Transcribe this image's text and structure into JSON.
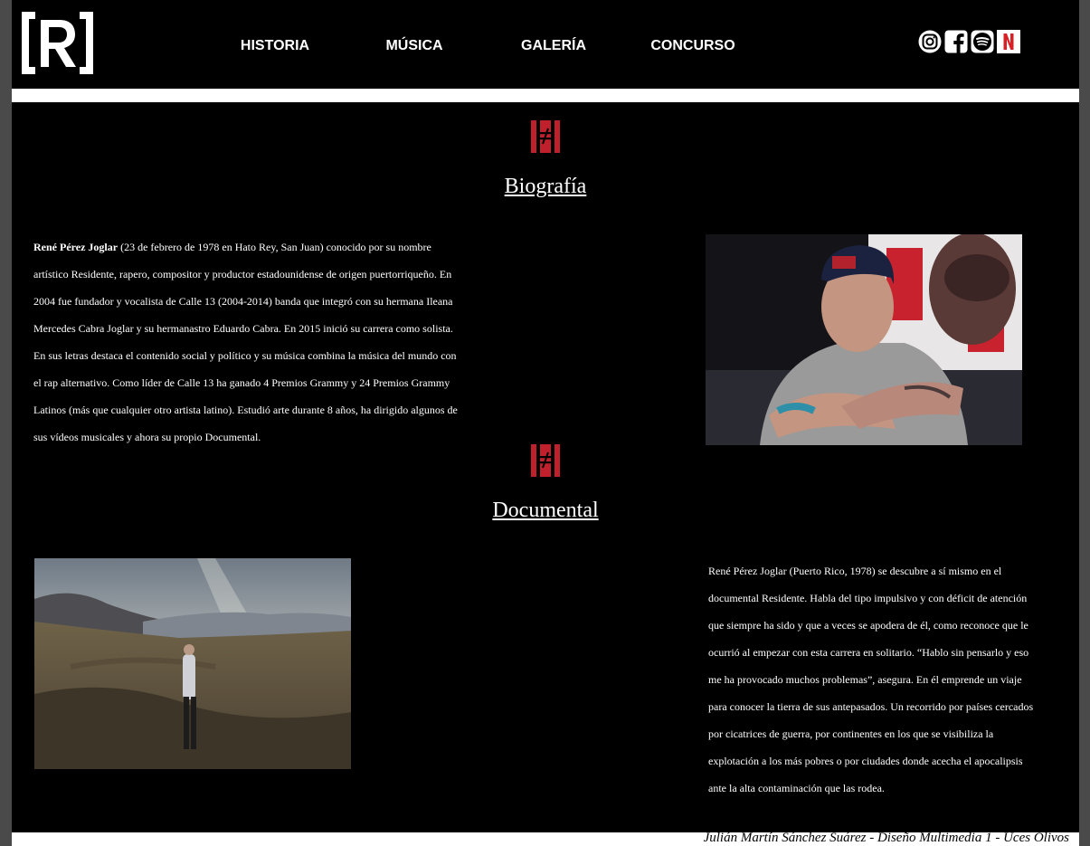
{
  "header": {
    "logo_text": "[R]",
    "nav": [
      {
        "label": "HISTORIA"
      },
      {
        "label": "MÚSICA"
      },
      {
        "label": "GALERÍA"
      },
      {
        "label": "CONCURSO"
      }
    ],
    "social_icons": [
      "instagram-icon",
      "facebook-icon",
      "spotify-icon",
      "netflix-icon"
    ]
  },
  "biography": {
    "title": "Biografía",
    "name_bold": "René Pérez Joglar",
    "text": " (23 de febrero de 1978 en Hato Rey, San Juan) conocido por su nombre artístico Residente, rapero, compositor y productor estadounidense de origen puertorriqueño. En 2004 fue fundador y vocalista de Calle 13 (2004-2014) banda que integró con su hermana Ileana Mercedes Cabra Joglar y su hermanastro Eduardo Cabra. En 2015 inició su carrera como solista. En sus letras destaca el contenido social y político y su música combina la música del mundo con el rap alternativo. Como líder de Calle 13 ha ganado 4 Premios Grammy y 24 Premios Grammy Latinos (más que cualquier otro artista latino). Estudió arte durante 8 años, ha dirigido algunos de sus vídeos musicales y ahora su propio Documental."
  },
  "documentary": {
    "title": "Documental",
    "text": "René Pérez Joglar (Puerto Rico, 1978) se descubre a sí mismo en el documental Residente. Habla del tipo impulsivo y con déficit de atención que siempre ha sido y que a veces se apodera de él, como reconoce que le ocurrió al empezar con esta carrera en solitario. “Hablo sin pensarlo y eso me ha provocado muchos problemas”, asegura. En él emprende un viaje para conocer la tierra de sus antepasados. Un recorrido por países cercados por cicatrices de guerra, por continentes en los que se visibiliza la explotación a los más pobres o por ciudades donde acecha el apocalipsis ante la alta contaminación que las rodea."
  },
  "footer": {
    "text": "Julián Martín Sánchez Suárez - Diseño Multimedia 1 - Uces Olivos"
  },
  "colors": {
    "accent_red": "#c0202c",
    "background": "#000000",
    "text": "#ffffff"
  }
}
